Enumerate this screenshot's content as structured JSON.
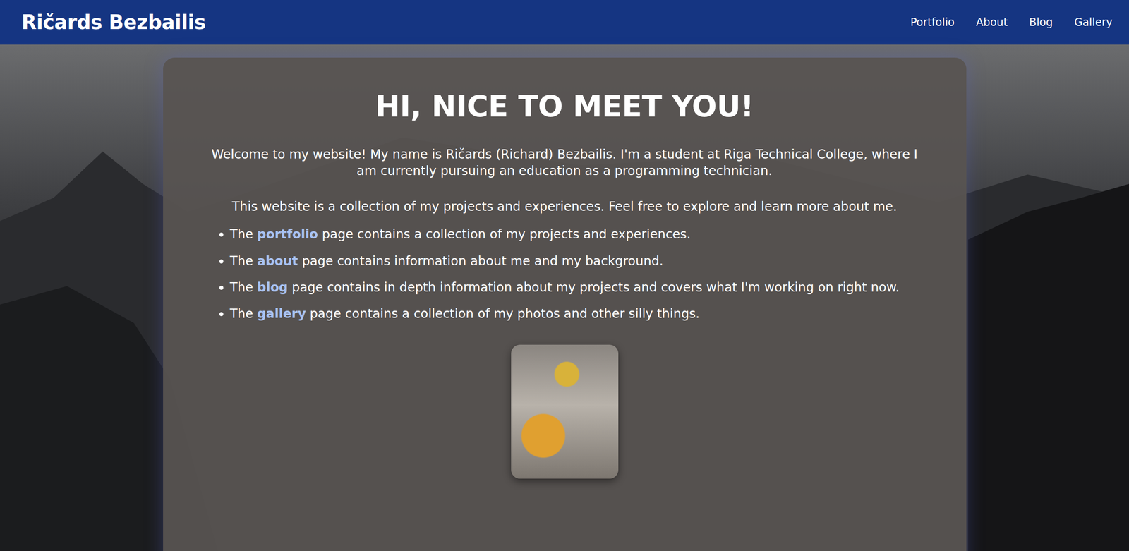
{
  "nav": {
    "brand": "Ričards Bezbailis",
    "links": [
      "Portfolio",
      "About",
      "Blog",
      "Gallery"
    ]
  },
  "heading": "HI, NICE TO MEET YOU!",
  "intro": "Welcome to my website! My name is Ričards (Richard) Bezbailis. I'm a student at Riga Technical College, where I am currently pursuing an education as a programming technician.",
  "summary": "This website is a collection of my projects and experiences. Feel free to explore and learn more about me.",
  "items": [
    {
      "before": "The ",
      "link": "portfolio",
      "after": " page contains a collection of my projects and experiences."
    },
    {
      "before": "The ",
      "link": "about",
      "after": " page contains information about me and my background."
    },
    {
      "before": "The ",
      "link": "blog",
      "after": " page contains in depth information about my projects and covers what I'm working on right now."
    },
    {
      "before": "The ",
      "link": "gallery",
      "after": " page contains a collection of my photos and other silly things."
    }
  ]
}
